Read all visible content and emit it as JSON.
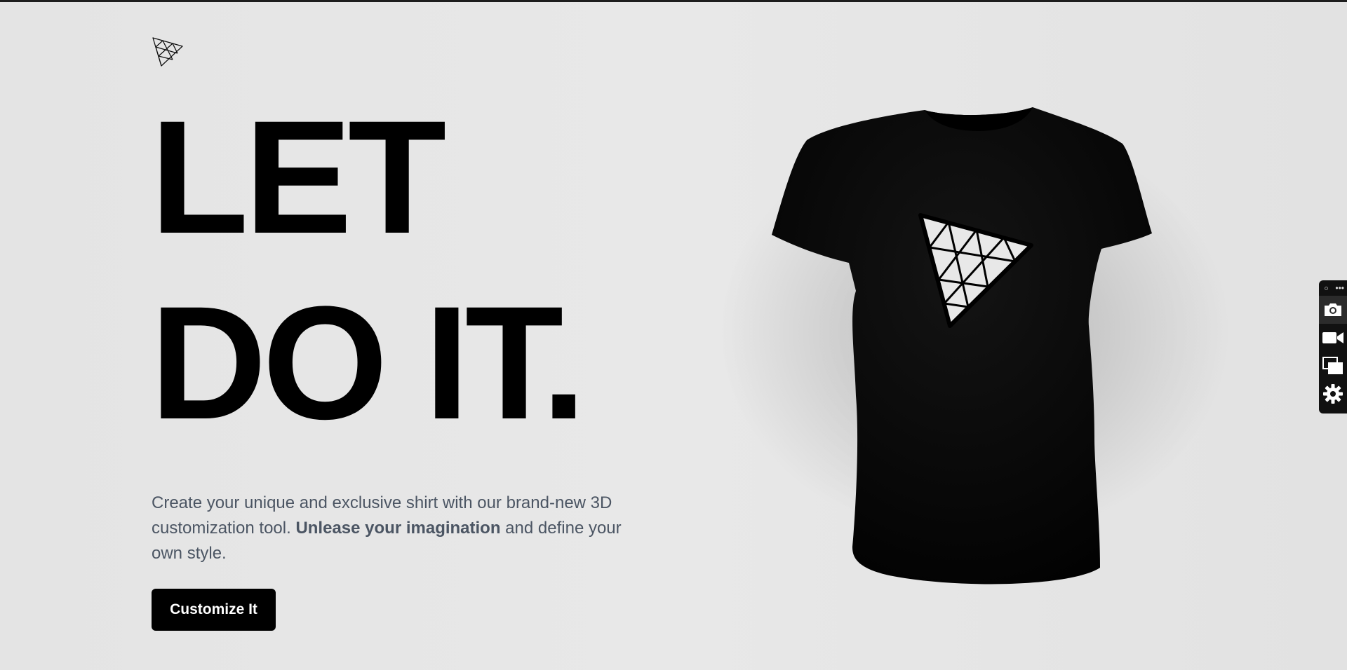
{
  "hero": {
    "headline_line1": "LET",
    "headline_line2": "DO IT.",
    "description_part1": "Create your unique and exclusive shirt with our brand-new 3D customization tool. ",
    "description_bold": "Unlease your imagination",
    "description_part2": " and define your own style.",
    "cta_label": "Customize It"
  },
  "toolbar": {
    "more_label": "•••",
    "tools": [
      "camera-icon",
      "video-camera-icon",
      "layers-icon",
      "gear-icon"
    ]
  },
  "colors": {
    "background": "#e6e6e6",
    "headline": "#000000",
    "description": "#4b5563",
    "button_bg": "#000000",
    "button_text": "#ffffff",
    "shirt": "#050505"
  }
}
